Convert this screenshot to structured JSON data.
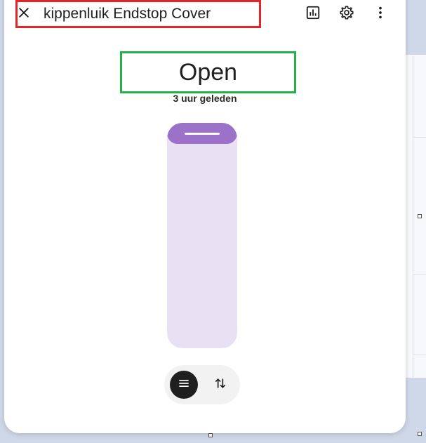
{
  "dialog": {
    "title": "kippenluik Endstop Cover",
    "close_icon": "close-icon",
    "history_icon": "chart-icon",
    "settings_icon": "gear-icon",
    "more_icon": "more-vert-icon"
  },
  "cover": {
    "state": "Open",
    "last_changed": "3 uur geleden",
    "position": 0.09
  },
  "controls": {
    "modes": [
      {
        "icon": "menu-icon",
        "active": true
      },
      {
        "icon": "swap-vert-icon",
        "active": false
      }
    ]
  },
  "colors": {
    "accent": "#9b71c9",
    "slider_track": "#e8e1f3",
    "highlight_red": "#e0262b",
    "highlight_green": "#22b14c"
  }
}
